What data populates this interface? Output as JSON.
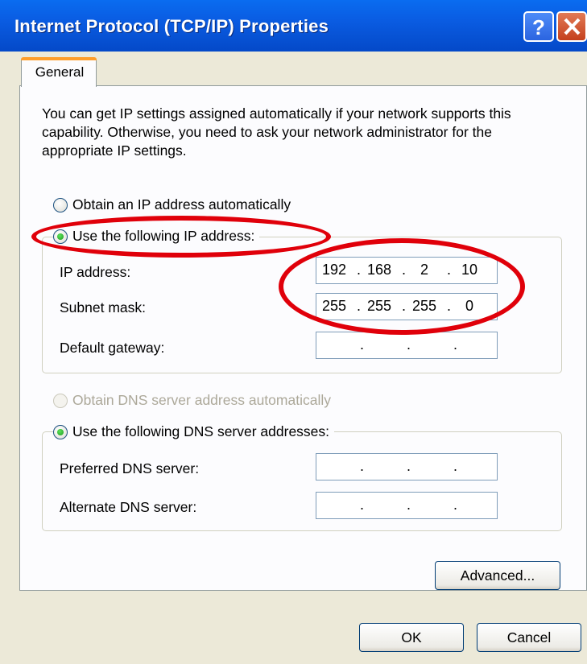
{
  "window": {
    "title": "Internet Protocol (TCP/IP) Properties"
  },
  "tabs": [
    {
      "label": "General",
      "active": true
    }
  ],
  "description": "You can get IP settings assigned automatically if your network supports this capability. Otherwise, you need to ask your network administrator for the appropriate IP settings.",
  "ip_mode": {
    "auto_label": "Obtain an IP address automatically",
    "manual_label": "Use the following IP address:",
    "selected": "manual"
  },
  "ip_fields": {
    "ip_address": {
      "label": "IP address:",
      "octets": [
        "192",
        "168",
        "2",
        "10"
      ]
    },
    "subnet_mask": {
      "label": "Subnet mask:",
      "octets": [
        "255",
        "255",
        "255",
        "0"
      ]
    },
    "default_gateway": {
      "label": "Default gateway:",
      "octets": [
        "",
        "",
        "",
        ""
      ]
    }
  },
  "dns_mode": {
    "auto_label": "Obtain DNS server address automatically",
    "auto_disabled": true,
    "manual_label": "Use the following DNS server addresses:",
    "selected": "manual"
  },
  "dns_fields": {
    "preferred": {
      "label": "Preferred DNS server:",
      "octets": [
        "",
        "",
        "",
        ""
      ]
    },
    "alternate": {
      "label": "Alternate DNS server:",
      "octets": [
        "",
        "",
        "",
        ""
      ]
    }
  },
  "buttons": {
    "advanced": "Advanced...",
    "ok": "OK",
    "cancel": "Cancel"
  },
  "colors": {
    "title_bar": "#0a5ce2",
    "dialog_face": "#ece9d8",
    "annotation": "#e0000a",
    "radio_selected": "#1f9a1f"
  }
}
